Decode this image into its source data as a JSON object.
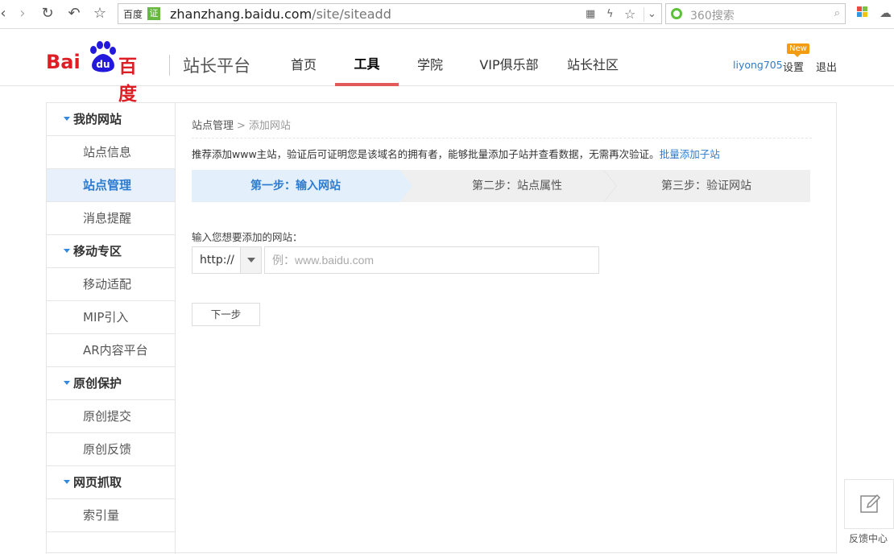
{
  "browser": {
    "address_site_label": "百度",
    "cert_badge": "证",
    "url_host": "zhanzhang.baidu.com",
    "url_path": "/site/siteadd",
    "search_placeholder": "360搜索"
  },
  "header": {
    "logo_text_latin": "Bai",
    "logo_paw_text": "du",
    "logo_text_cn": "百度",
    "product_name": "站长平台",
    "nav": [
      "首页",
      "工具",
      "学院",
      "VIP俱乐部",
      "站长社区"
    ],
    "active_nav": "工具",
    "username": "liyong705",
    "settings_label": "设置",
    "new_badge": "New",
    "logout_label": "退出"
  },
  "sidebar": [
    {
      "label": "我的网站",
      "type": "group"
    },
    {
      "label": "站点信息",
      "type": "item"
    },
    {
      "label": "站点管理",
      "type": "item",
      "active": true
    },
    {
      "label": "消息提醒",
      "type": "item"
    },
    {
      "label": "移动专区",
      "type": "group"
    },
    {
      "label": "移动适配",
      "type": "item"
    },
    {
      "label": "MIP引入",
      "type": "item"
    },
    {
      "label": "AR内容平台",
      "type": "item"
    },
    {
      "label": "原创保护",
      "type": "group"
    },
    {
      "label": "原创提交",
      "type": "item"
    },
    {
      "label": "原创反馈",
      "type": "item"
    },
    {
      "label": "网页抓取",
      "type": "group"
    },
    {
      "label": "索引量",
      "type": "item"
    }
  ],
  "main": {
    "breadcrumb_parent": "站点管理",
    "breadcrumb_sep": ">",
    "breadcrumb_current": "添加网站",
    "tip_text": "推荐添加www主站，验证后可证明您是该域名的拥有者，能够批量添加子站并查看数据，无需再次验证。",
    "tip_link": "批量添加子站",
    "steps": [
      "第一步：输入网站",
      "第二步：站点属性",
      "第三步：验证网站"
    ],
    "input_label": "输入您想要添加的网站：",
    "protocol_value": "http://",
    "url_placeholder": "例：www.baidu.com",
    "next_button": "下一步"
  },
  "feedback": {
    "label": "反馈中心"
  },
  "colors": {
    "brand_red": "#de1e25",
    "brand_blue": "#2d7bd1",
    "nav_underline": "#e35859",
    "active_step_bg": "#e3f0fc",
    "badge_orange": "#f39c12"
  }
}
